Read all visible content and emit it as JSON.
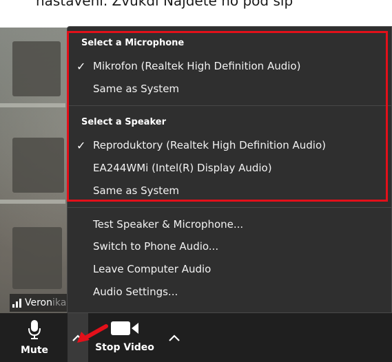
{
  "caption": "nastavení. Zvukdl Najdete ho pod sip",
  "participant": {
    "name_visible": "Veron",
    "name_faded": "ika Štěpánková"
  },
  "menu": {
    "microphone_section": {
      "title": "Select a Microphone",
      "items": [
        {
          "label": "Mikrofon (Realtek High Definition Audio)",
          "checked": true
        },
        {
          "label": "Same as System",
          "checked": false
        }
      ]
    },
    "speaker_section": {
      "title": "Select a Speaker",
      "items": [
        {
          "label": "Reproduktory (Realtek High Definition Audio)",
          "checked": true
        },
        {
          "label": "EA244WMi (Intel(R) Display Audio)",
          "checked": false
        },
        {
          "label": "Same as System",
          "checked": false
        }
      ]
    },
    "actions": [
      "Test Speaker & Microphone...",
      "Switch to Phone Audio...",
      "Leave Computer Audio",
      "Audio Settings..."
    ],
    "check_glyph": "✓"
  },
  "toolbar": {
    "mute_label": "Mute",
    "video_label": "Stop Video"
  },
  "colors": {
    "menu_bg": "#2f2f2f",
    "toolbar_bg": "#1f1f1f",
    "highlight": "#e3101a"
  }
}
